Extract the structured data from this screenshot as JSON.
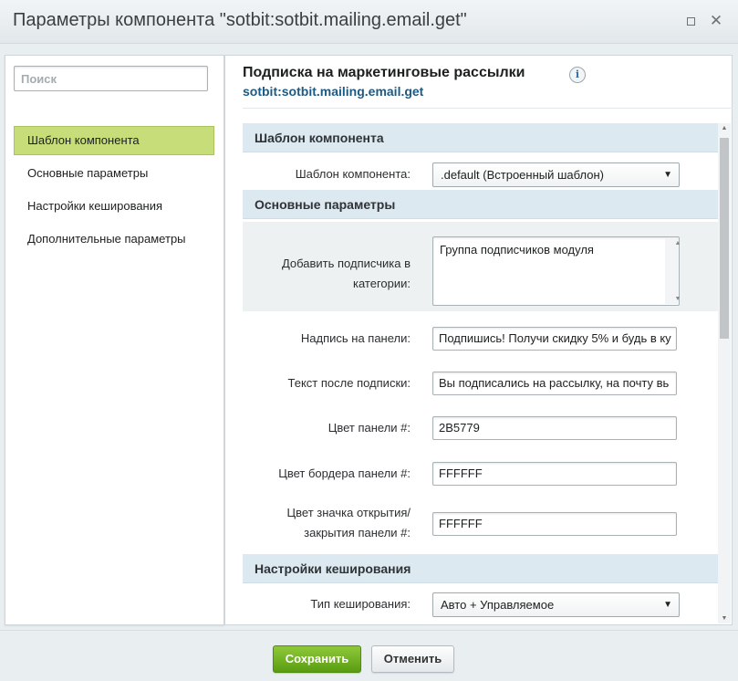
{
  "window": {
    "title": "Параметры компонента \"sotbit:sotbit.mailing.email.get\"",
    "maximize_icon": "maximize-icon",
    "close_icon": "close-icon",
    "close_glyph": "✕"
  },
  "sidebar": {
    "search_placeholder": "Поиск",
    "items": [
      {
        "label": "Шаблон компонента",
        "active": true
      },
      {
        "label": "Основные параметры",
        "active": false
      },
      {
        "label": "Настройки кеширования",
        "active": false
      },
      {
        "label": "Дополнительные параметры",
        "active": false
      }
    ]
  },
  "main": {
    "heading": "Подписка на маркетинговые рассылки",
    "info_glyph": "i",
    "component_id": "sotbit:sotbit.mailing.email.get",
    "sections": {
      "template": {
        "title": "Шаблон компонента",
        "template_label": "Шаблон компонента:",
        "template_value": ".default (Встроенный шаблон)"
      },
      "basic": {
        "title": "Основные параметры",
        "category_label": "Добавить подписчика в категории:",
        "category_value": "Группа подписчиков модуля",
        "panel_text_label": "Надпись на панели:",
        "panel_text_value": "Подпишись! Получи скидку 5% и будь в ку",
        "after_text_label": "Текст после подписки:",
        "after_text_value": "Вы подписались на рассылку, на почту вь",
        "panel_color_label": "Цвет панели #:",
        "panel_color_value": "2B5779",
        "border_color_label": "Цвет бордера панели #:",
        "border_color_value": "FFFFFF",
        "toggle_color_label": "Цвет значка открытия/ закрытия панели #:",
        "toggle_color_value": "FFFFFF"
      },
      "cache": {
        "title": "Настройки кеширования",
        "cache_type_label": "Тип кеширования:",
        "cache_type_value": "Авто + Управляемое"
      }
    },
    "select_arrow": "▼",
    "scroll_up": "▲",
    "scroll_down": "▼"
  },
  "footer": {
    "save_label": "Сохранить",
    "cancel_label": "Отменить"
  },
  "colors": {
    "accent_green": "#6aab1e",
    "active_item": "#c6dd79",
    "section_header": "#dce9f1",
    "link_blue": "#1d5a83"
  }
}
